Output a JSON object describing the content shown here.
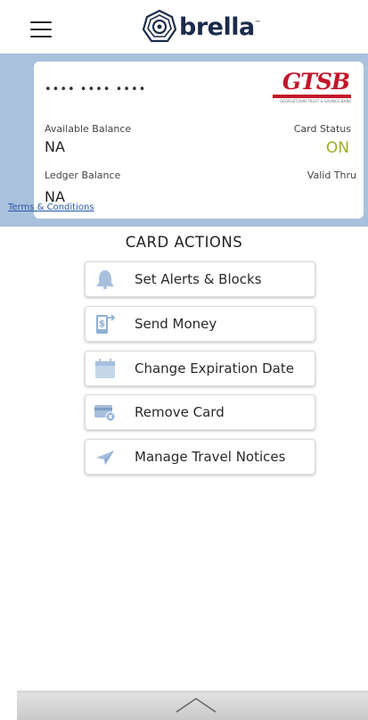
{
  "header": {
    "menu_icon": "hamburger-menu-icon",
    "logo_text": "brella",
    "logo_trademark": "™",
    "logo_icon": "brella-emblem-icon"
  },
  "card": {
    "number_masked": "•••• •••• ••••",
    "bank_logo_text": "GTSB",
    "bank_logo_subtitle": "GEORGETOWN TRUST & SAVINGS BANK",
    "available_balance_label": "Available Balance",
    "available_balance_value": "NA",
    "card_status_label": "Card Status",
    "card_status_value": "ON",
    "ledger_balance_label": "Ledger Balance",
    "ledger_balance_value": "NA",
    "valid_thru_label": "Valid Thru",
    "terms_link": "Terms & Conditions"
  },
  "actions": {
    "title": "CARD ACTIONS",
    "items": [
      {
        "label": "Set Alerts & Blocks",
        "icon": "bell-icon"
      },
      {
        "label": "Send Money",
        "icon": "send-money-phone-icon"
      },
      {
        "label": "Change Expiration Date",
        "icon": "calendar-icon"
      },
      {
        "label": "Remove Card",
        "icon": "remove-card-icon"
      },
      {
        "label": "Manage Travel Notices",
        "icon": "paper-plane-icon"
      }
    ]
  },
  "bottom": {
    "icon": "chevron-up-icon"
  },
  "colors": {
    "card_panel_bg": "#a9c1dd",
    "status_on": "#9cb022",
    "bank_red": "#c4162a",
    "link_blue": "#2455a6",
    "icon_blue": "#a6bfdc"
  }
}
